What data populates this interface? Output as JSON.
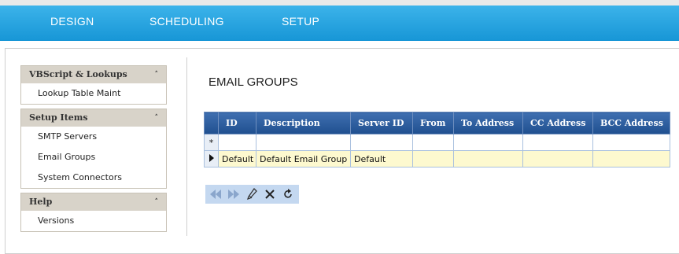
{
  "nav": {
    "items": [
      "DESIGN",
      "SCHEDULING",
      "SETUP"
    ]
  },
  "sidebar": {
    "sections": [
      {
        "title": "VBScript & Lookups",
        "items": [
          "Lookup Table Maint"
        ]
      },
      {
        "title": "Setup Items",
        "items": [
          "SMTP Servers",
          "Email Groups",
          "System Connectors"
        ]
      },
      {
        "title": "Help",
        "items": [
          "Versions"
        ]
      }
    ]
  },
  "page": {
    "title": "EMAIL GROUPS"
  },
  "grid": {
    "columns": [
      "ID",
      "Description",
      "Server ID",
      "From",
      "To Address",
      "CC Address",
      "BCC Address"
    ],
    "new_row_marker": "*",
    "rows": [
      [
        "Default",
        "Default Email Group",
        "Default",
        "",
        "",
        "",
        ""
      ]
    ]
  },
  "toolbar": {
    "icons": [
      "first-icon",
      "last-icon",
      "edit-icon",
      "delete-icon",
      "refresh-icon"
    ]
  },
  "colors": {
    "nav_bar": "#1e9fdf",
    "grid_header": "#2a5a9a",
    "data_row": "#fdf9cf",
    "sidebar_header": "#d8d3c9"
  }
}
